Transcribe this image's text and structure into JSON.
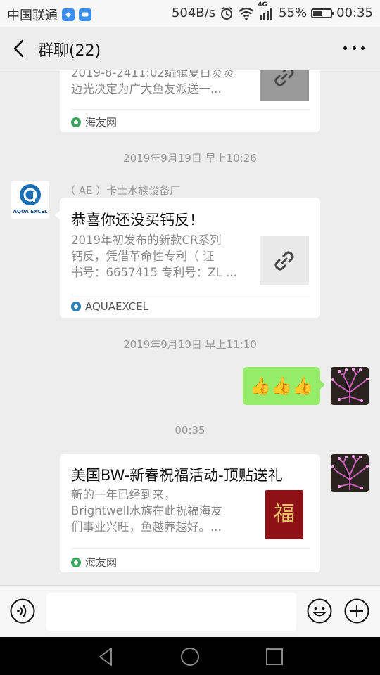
{
  "status_bar": {
    "carrier": "中国联通",
    "network_speed": "504B/s",
    "network_type": "4G",
    "battery_percent": "55%",
    "battery_level": 0.55,
    "time": "00:35"
  },
  "nav": {
    "title": "群聊(22)"
  },
  "messages": {
    "card1": {
      "desc": "2019-8-2411:02编辑夏日炎炎\n迈光决定为广大鱼友派送一...",
      "source": "海友网"
    },
    "time1": "2019年9月19日 早上10:26",
    "card2": {
      "sender": "（ AE ）卡士水族设备厂",
      "avatar_text": "AQUA EXCEL",
      "title": "恭喜你还没买钙反！",
      "desc": "2019年初发布的新款CR系列\n钙反，凭借革命性专利（ 证\n书号：6657415 专利号：ZL ...",
      "source": "AQUAEXCEL"
    },
    "time2": "2019年9月19日 早上11:10",
    "reply": "👍👍👍",
    "time3": "00:35",
    "card3": {
      "title": "美国BW-新春祝福活动-顶贴送礼",
      "desc": "新的一年已经到来，\nBrightwell水族在此祝福海友\n们事业兴旺，鱼越养越好。...",
      "thumb_text": "福",
      "source": "海友网"
    }
  },
  "input": {
    "placeholder": ""
  }
}
